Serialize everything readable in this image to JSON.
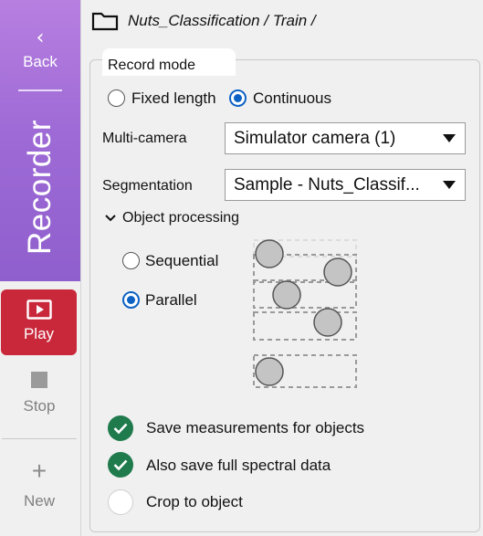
{
  "sidebar": {
    "back_label": "Back",
    "title": "Recorder",
    "play_label": "Play",
    "stop_label": "Stop",
    "new_label": "New",
    "accent_color": "#9f6bd6",
    "play_color": "#c8283a"
  },
  "header": {
    "path": "Nuts_Classification / Train /"
  },
  "record_mode": {
    "legend": "Record mode",
    "options": [
      {
        "label": "Fixed length",
        "selected": false
      },
      {
        "label": "Continuous",
        "selected": true
      }
    ],
    "multi_camera": {
      "label": "Multi-camera",
      "value": "Simulator camera (1)"
    },
    "segmentation": {
      "label": "Segmentation",
      "value": "Sample - Nuts_Classif..."
    },
    "object_processing": {
      "label": "Object processing",
      "expanded": true,
      "options": [
        {
          "label": "Sequential",
          "selected": false
        },
        {
          "label": "Parallel",
          "selected": true
        }
      ]
    },
    "checks": [
      {
        "label": "Save measurements for objects",
        "checked": true
      },
      {
        "label": "Also save full spectral data",
        "checked": true
      },
      {
        "label": "Crop to object",
        "checked": false
      }
    ],
    "check_color": "#1f7a4c",
    "radio_color": "#0d62c4"
  }
}
